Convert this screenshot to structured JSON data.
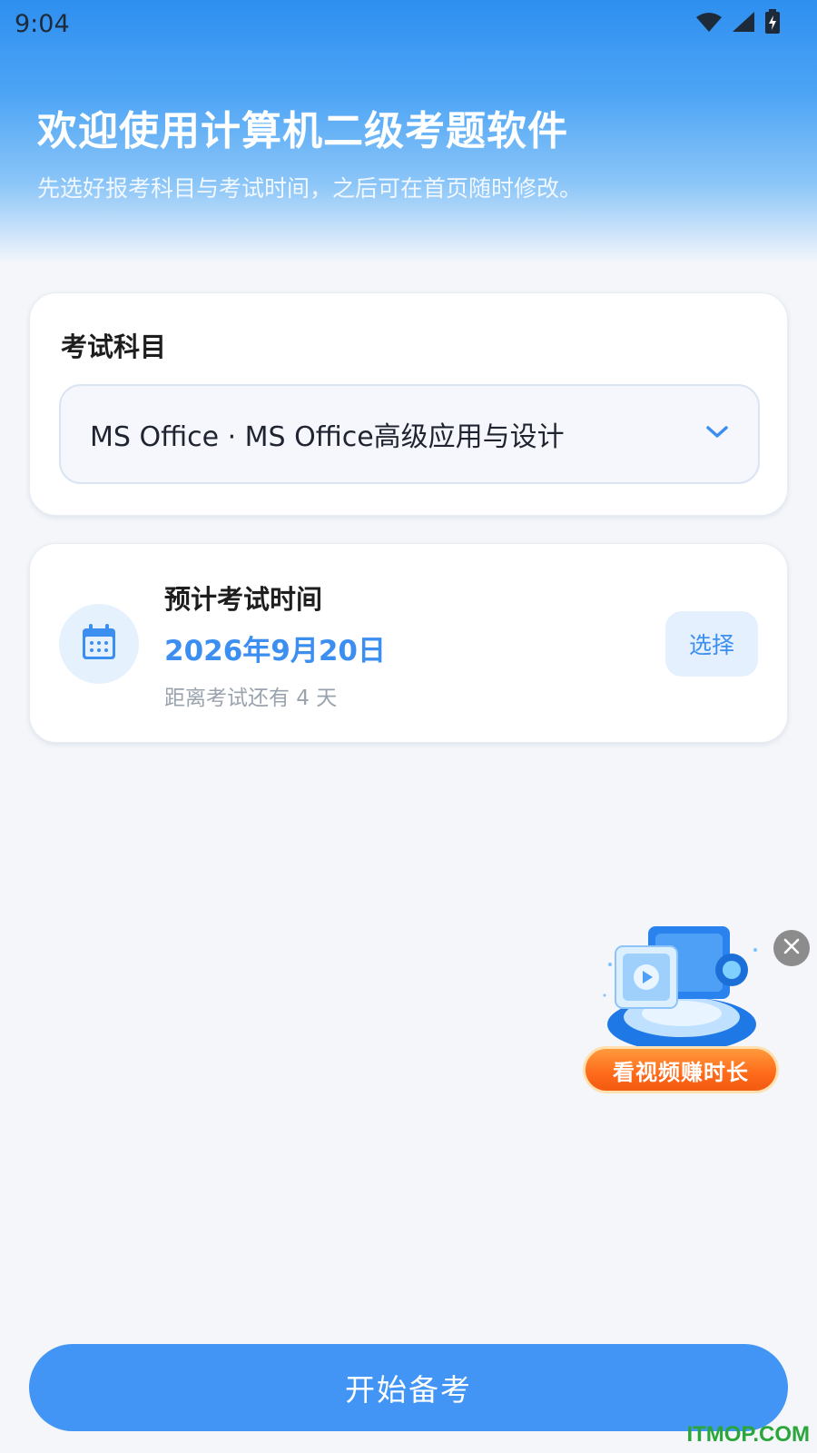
{
  "status_bar": {
    "time": "9:04",
    "icons": [
      "wifi-icon",
      "signal-icon",
      "battery-icon"
    ]
  },
  "header": {
    "title": "欢迎使用计算机二级考题软件",
    "subtitle": "先选好报考科目与考试时间，之后可在首页随时修改。"
  },
  "subject_card": {
    "label": "考试科目",
    "selected_value": "MS Office · MS Office高级应用与设计"
  },
  "date_card": {
    "label": "预计考试时间",
    "date": "2026年9月20日",
    "countdown": "距离考试还有 4 天",
    "choose_label": "选择"
  },
  "floating_ad": {
    "label": "看视频赚时长"
  },
  "footer": {
    "start_label": "开始备考"
  },
  "watermark": "ITMOP.COM",
  "colors": {
    "accent": "#4295f4",
    "accent_text": "#3c8ff0",
    "background": "#f4f6fa",
    "ad_orange": "#ff6a1a"
  }
}
